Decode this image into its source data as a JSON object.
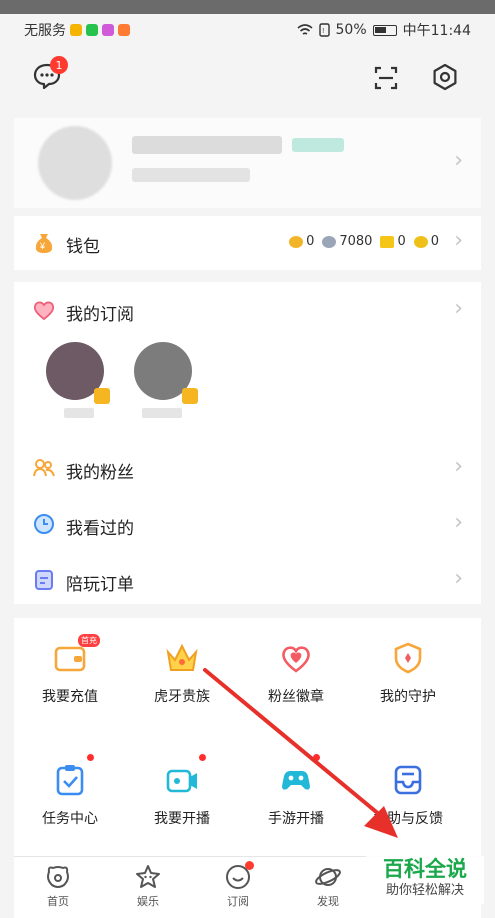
{
  "status_bar": {
    "carrier": "无服务",
    "battery": "50%",
    "time": "中午11:44"
  },
  "top_bar": {
    "message_badge": "1",
    "icons": [
      "message-icon",
      "scan-icon",
      "settings-icon"
    ]
  },
  "wallet": {
    "label": "钱包",
    "balances": [
      "0",
      "7080",
      "0",
      "0"
    ]
  },
  "subscriptions": {
    "label": "我的订阅"
  },
  "menu": {
    "fans": "我的粉丝",
    "history": "我看过的",
    "companion_orders": "陪玩订单"
  },
  "grid": {
    "recharge": {
      "label": "我要充值",
      "tag": "首充"
    },
    "noble": {
      "label": "虎牙贵族"
    },
    "fan_badge": {
      "label": "粉丝徽章"
    },
    "guard": {
      "label": "我的守护"
    },
    "tasks": {
      "label": "任务中心"
    },
    "start_live": {
      "label": "我要开播"
    },
    "mobile_live": {
      "label": "手游开播"
    },
    "help": {
      "label": "帮助与反馈"
    }
  },
  "tabs": [
    {
      "label": "首页"
    },
    {
      "label": "娱乐"
    },
    {
      "label": "订阅"
    },
    {
      "label": "发现"
    }
  ],
  "watermark": {
    "title": "百科全说",
    "subtitle": "助你轻松解决"
  },
  "colors": {
    "accent_orange": "#f7a73a",
    "badge_red": "#ff3b30",
    "watermark_green": "#1aa84a",
    "arrow_red": "#e8302a"
  }
}
